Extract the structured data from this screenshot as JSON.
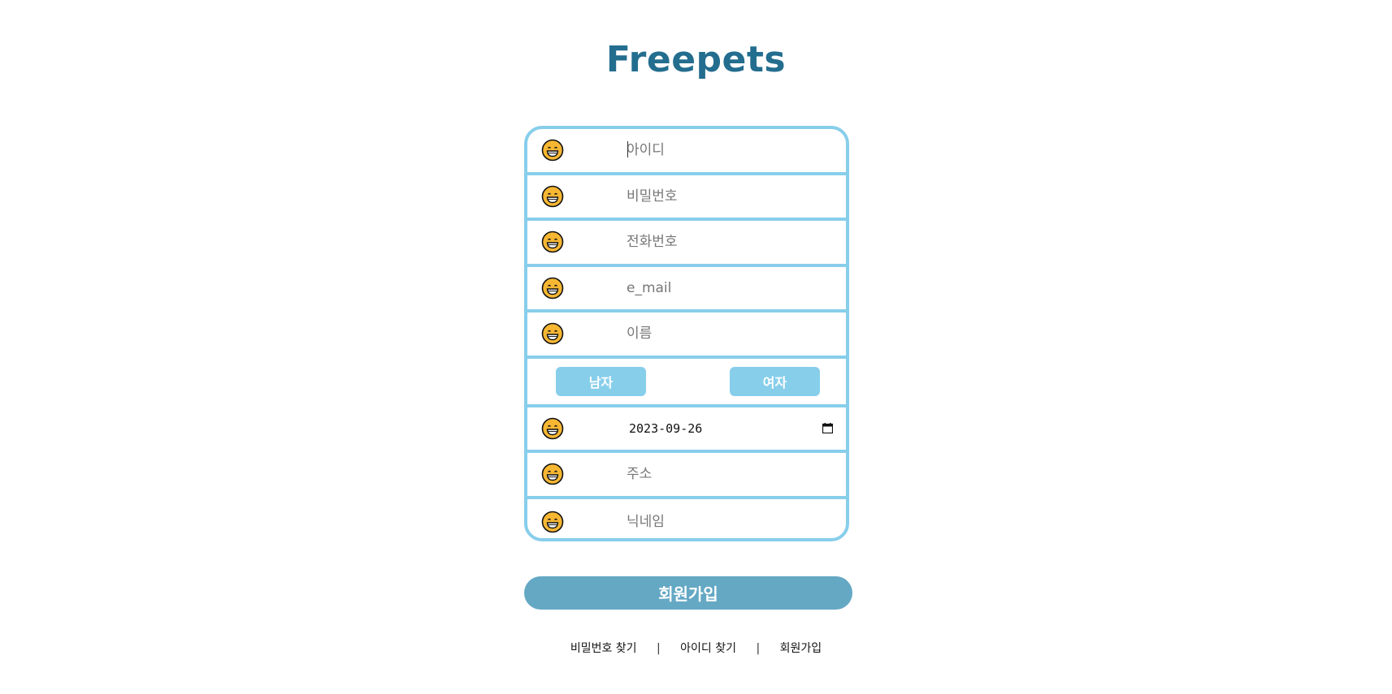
{
  "app": {
    "title": "Freepets"
  },
  "form": {
    "fields": [
      {
        "placeholder": "아이디",
        "value": "",
        "icon": "grinning-face-icon"
      },
      {
        "placeholder": "비밀번호",
        "value": "",
        "icon": "grinning-face-icon"
      },
      {
        "placeholder": "전화번호",
        "value": "",
        "icon": "grinning-face-icon"
      },
      {
        "placeholder": "e_mail",
        "value": "",
        "icon": "grinning-face-icon"
      },
      {
        "placeholder": "이름",
        "value": "",
        "icon": "grinning-face-icon"
      }
    ],
    "gender": {
      "male_label": "남자",
      "female_label": "여자"
    },
    "birthdate": {
      "value": "2023-09-26",
      "icon": "grinning-face-icon"
    },
    "address": {
      "placeholder": "주소",
      "value": "",
      "icon": "grinning-face-icon"
    },
    "nickname": {
      "placeholder": "닉네임",
      "value": "",
      "icon": "grinning-face-icon"
    }
  },
  "signup_button": {
    "label": "회원가입"
  },
  "footer": {
    "find_password": "비밀번호 찾기",
    "separator": "|",
    "find_id": "아이디 찾기",
    "signup": "회원가입"
  },
  "colors": {
    "title": "#236d8f",
    "border": "#87ceeb",
    "gender_button": "#87ceeb",
    "signup_button": "#64a8c4",
    "icon_face": "#f7b733"
  }
}
